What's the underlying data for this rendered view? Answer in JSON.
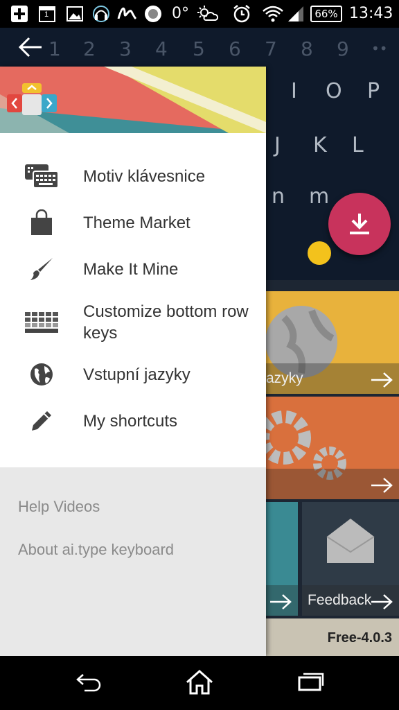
{
  "status_bar": {
    "calendar_day": "1",
    "temperature": "0°",
    "battery": "66%",
    "time": "13:43",
    "icons": [
      "add-box-icon",
      "calendar-icon",
      "image-icon",
      "headset-icon",
      "sign-icon",
      "record-icon",
      "weather-icon",
      "alarm-icon",
      "wifi-icon",
      "signal-icon",
      "battery-icon"
    ]
  },
  "background": {
    "number_row": [
      "1",
      "2",
      "3",
      "4",
      "5",
      "6",
      "7",
      "8",
      "9",
      "0"
    ],
    "keyboard_letters": [
      "I",
      "O",
      "P",
      "J",
      "K",
      "L",
      "n",
      "m"
    ],
    "tiles": {
      "languages_partial": "azyky",
      "feedback": "Feedback"
    },
    "version": "Free-4.0.3"
  },
  "drawer": {
    "menu": [
      {
        "label": "Motiv klávesnice",
        "icon": "keyboard-theme-icon"
      },
      {
        "label": "Theme Market",
        "icon": "shopping-bag-icon"
      },
      {
        "label": "Make It Mine",
        "icon": "paint-brush-icon"
      },
      {
        "label": "Customize bottom row keys",
        "icon": "keyboard-keys-icon"
      },
      {
        "label": "Vstupní jazyky",
        "icon": "globe-icon"
      },
      {
        "label": "My shortcuts",
        "icon": "pencil-icon"
      }
    ],
    "footer": {
      "help_videos": "Help Videos",
      "about": "About ai.type keyboard"
    }
  },
  "colors": {
    "accent_fab": "#c8335c",
    "drawer_header_coral": "#e56a5f",
    "drawer_header_teal": "#3f8f97",
    "drawer_header_yellow": "#e4dc6b",
    "tile_yellow": "#e8b23c",
    "tile_orange": "#d9703d",
    "tile_teal": "#3a8a93"
  }
}
